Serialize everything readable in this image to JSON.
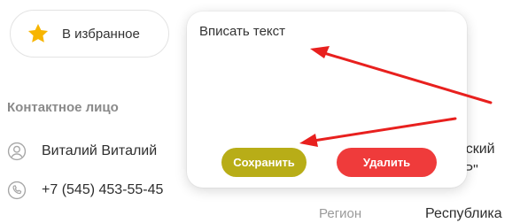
{
  "favorite": {
    "label": "В избранное",
    "icon": "star-icon",
    "icon_color": "#f7b500"
  },
  "contact": {
    "section_title": "Контактное лицо",
    "person_name": "Виталий Виталий",
    "person_icon": "user-circle-icon",
    "phone": "+7 (545) 453-55-45",
    "phone_icon": "phone-icon"
  },
  "details": {
    "line1": "анский",
    "line2": "ЭР\"",
    "region_label": "Регион",
    "region_value": "Республика"
  },
  "note_popover": {
    "placeholder": "Вписать текст",
    "save_label": "Сохранить",
    "delete_label": "Удалить"
  },
  "colors": {
    "save": "#b8ad17",
    "delete": "#ef3b3b",
    "arrow": "#e8201e"
  }
}
